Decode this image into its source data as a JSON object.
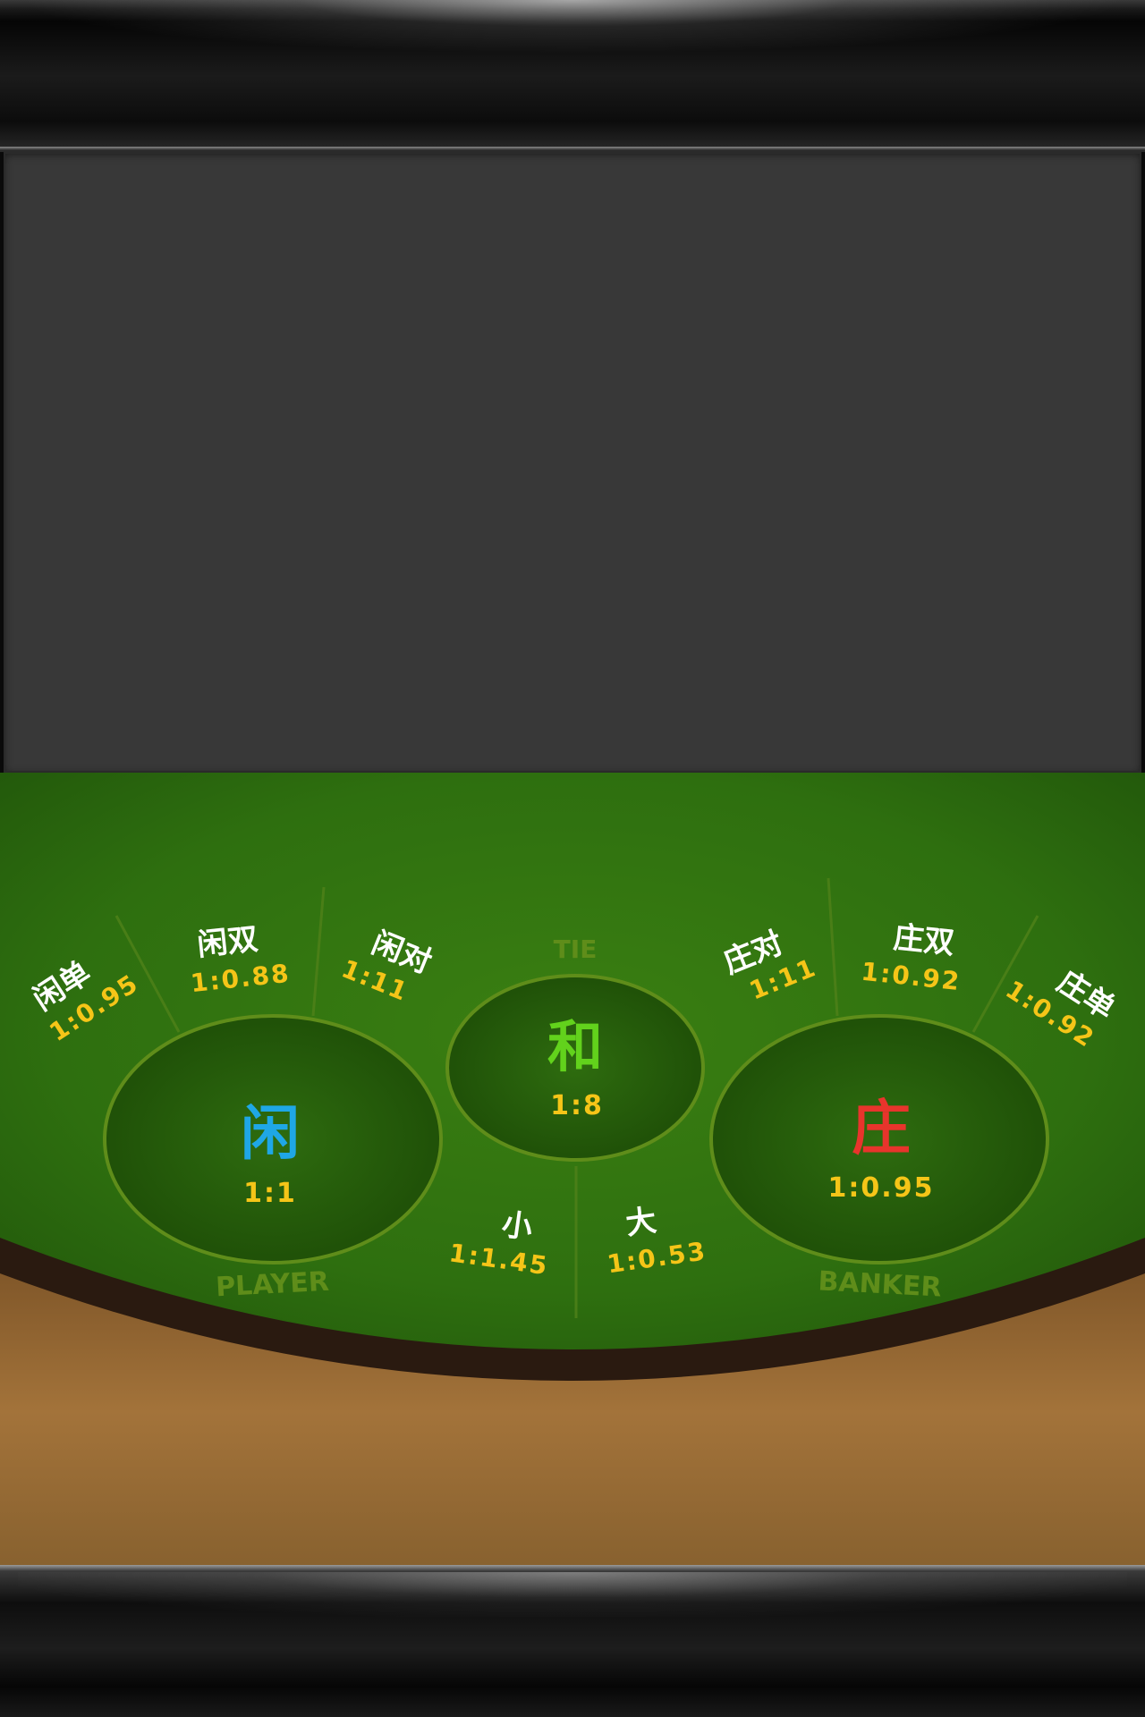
{
  "colors": {
    "felt": "#2e6f0f",
    "felt_dark": "#1d4a08",
    "zone_outline": "#5f8d1a",
    "odds_yellow": "#f5c518",
    "player_blue": "#1fa7e6",
    "banker_red": "#e8342c",
    "tie_green": "#62d21c",
    "wood": "#9a6a32"
  },
  "table": {
    "player": {
      "char": "闲",
      "odds": "1:1",
      "label": "PLAYER"
    },
    "banker": {
      "char": "庄",
      "odds": "1:0.95",
      "label": "BANKER"
    },
    "tie": {
      "char": "和",
      "odds": "1:8",
      "label": "TIE"
    },
    "side_bets": {
      "player_odd": {
        "name": "闲单",
        "odds": "1:0.95"
      },
      "player_even": {
        "name": "闲双",
        "odds": "1:0.88"
      },
      "player_pair": {
        "name": "闲对",
        "odds": "1:11"
      },
      "banker_pair": {
        "name": "庄对",
        "odds": "1:11"
      },
      "banker_even": {
        "name": "庄双",
        "odds": "1:0.92"
      },
      "banker_odd": {
        "name": "庄单",
        "odds": "1:0.92"
      },
      "small": {
        "name": "小",
        "odds": "1:1.45"
      },
      "big": {
        "name": "大",
        "odds": "1:0.53"
      }
    }
  }
}
